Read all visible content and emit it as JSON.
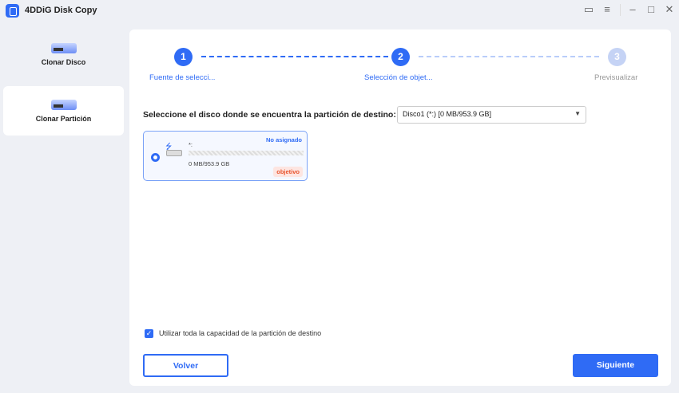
{
  "app": {
    "title": "4DDiG Disk Copy"
  },
  "sidebar": {
    "items": [
      {
        "label": "Clonar Disco"
      },
      {
        "label": "Clonar Partición"
      }
    ]
  },
  "steps": [
    {
      "num": "1",
      "label": "Fuente de selecci..."
    },
    {
      "num": "2",
      "label": "Selección de objet..."
    },
    {
      "num": "3",
      "label": "Previsualizar"
    }
  ],
  "main": {
    "question": "Seleccione el disco donde se encuentra la partición de destino:",
    "select_value": "Disco1 (*:) [0 MB/953.9 GB]",
    "card": {
      "name": "*:",
      "status": "No asignado",
      "size": "0 MB/953.9 GB",
      "badge": "objetivo"
    },
    "checkbox_label": "Utilizar toda la capacidad de la partición de destino",
    "back": "Volver",
    "next": "Siguiente"
  },
  "colors": {
    "accent": "#2f6bf5"
  }
}
